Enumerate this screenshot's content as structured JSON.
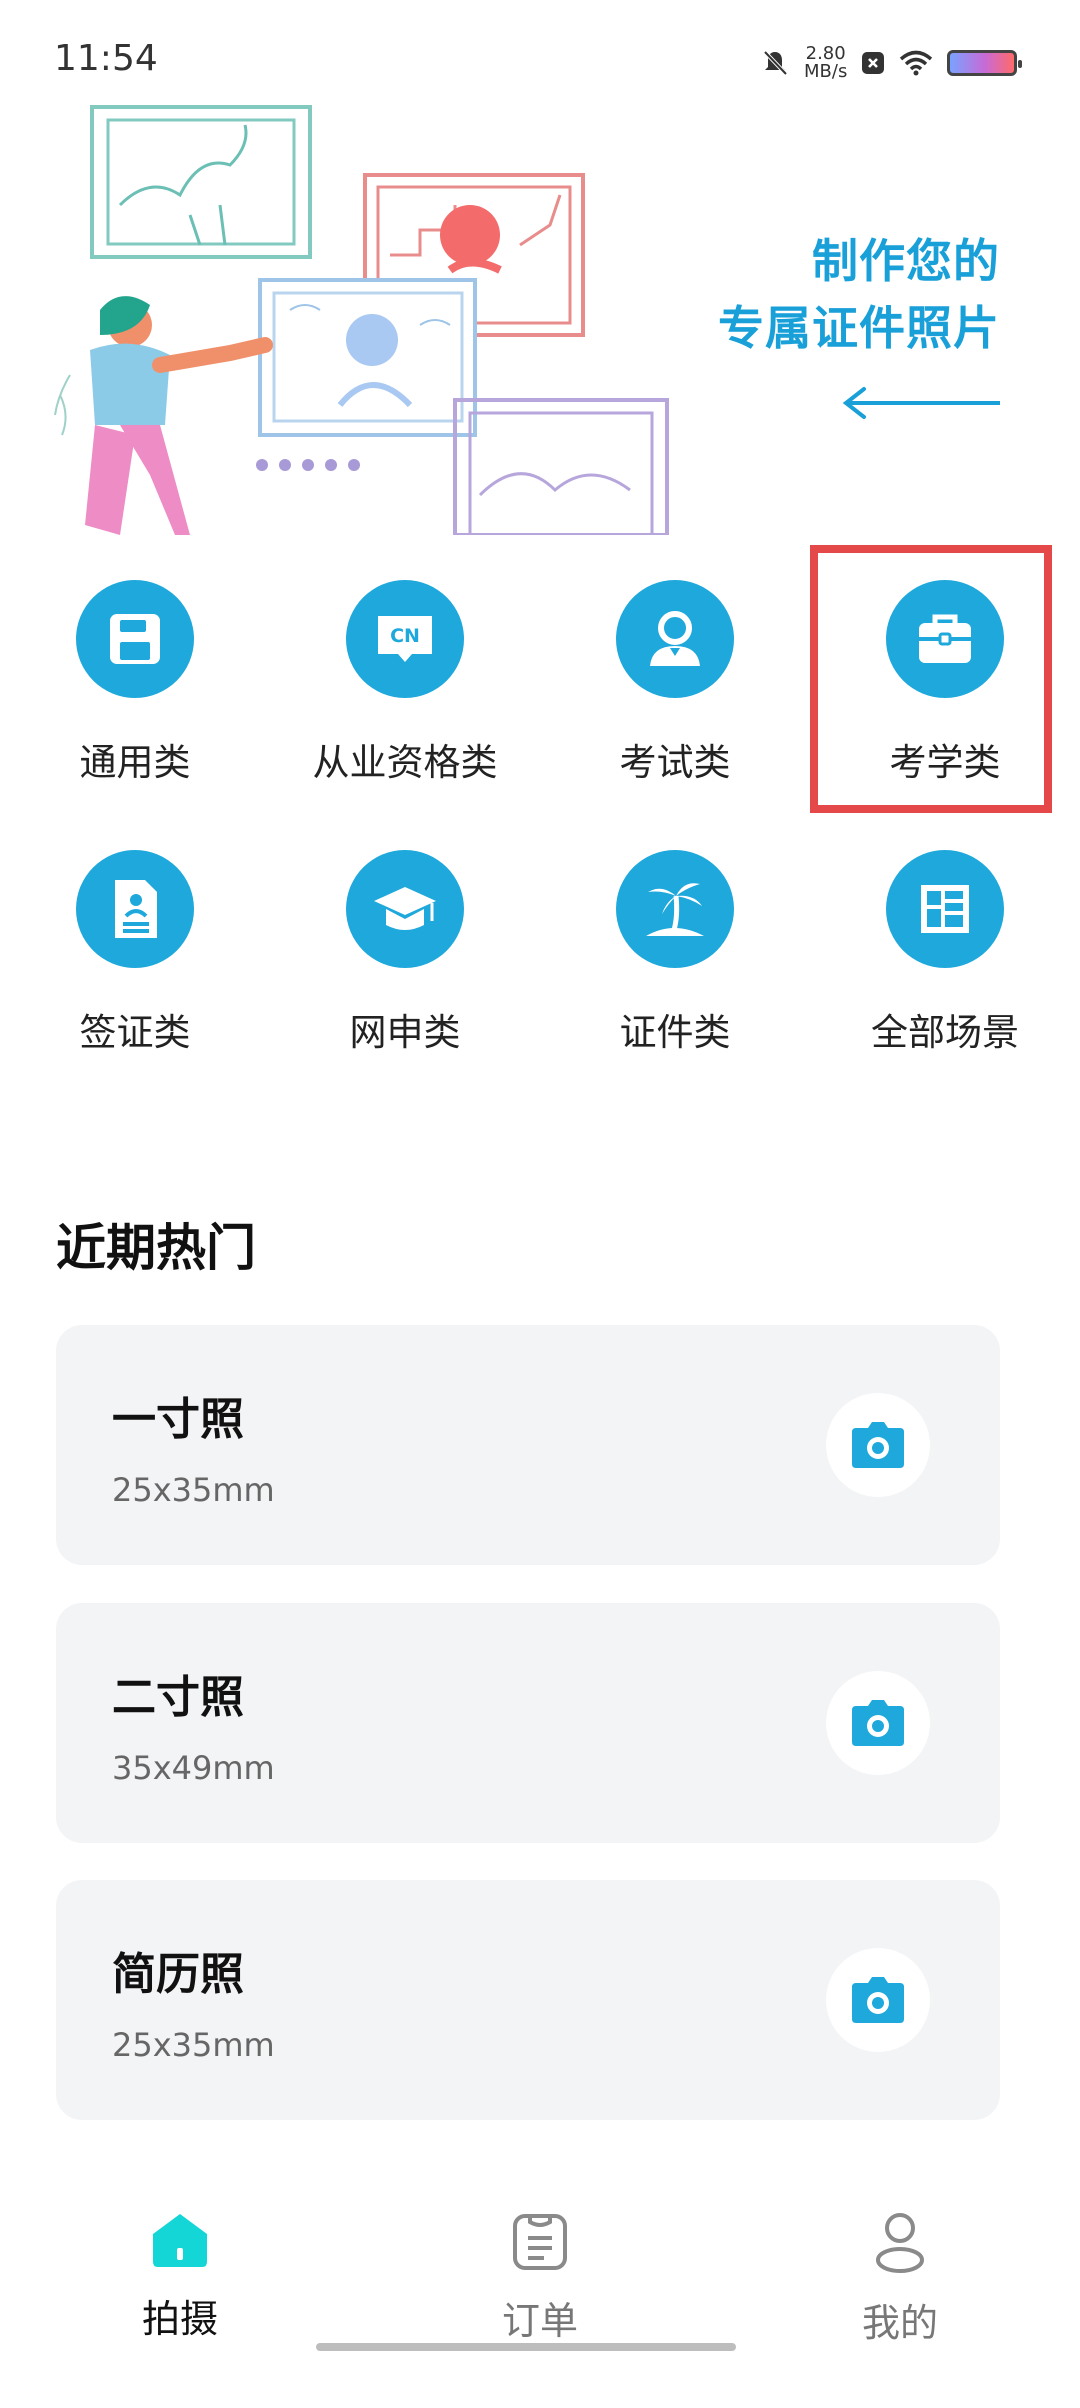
{
  "status_bar": {
    "time": "11:54",
    "speed_value": "2.80",
    "speed_unit": "MB/s"
  },
  "hero": {
    "line1": "制作您的",
    "line2": "专属证件照片"
  },
  "categories": [
    {
      "label": "通用类",
      "icon": "floppy-disk-icon"
    },
    {
      "label": "从业资格类",
      "icon": "cn-badge-icon",
      "badge": "CN"
    },
    {
      "label": "考试类",
      "icon": "person-icon"
    },
    {
      "label": "考学类",
      "icon": "briefcase-icon"
    },
    {
      "label": "签证类",
      "icon": "document-icon"
    },
    {
      "label": "网申类",
      "icon": "graduation-cap-icon"
    },
    {
      "label": "证件类",
      "icon": "palm-tree-icon"
    },
    {
      "label": "全部场景",
      "icon": "grid-layout-icon"
    }
  ],
  "recent": {
    "title": "近期热门",
    "items": [
      {
        "title": "一寸照",
        "size": "25x35mm"
      },
      {
        "title": "二寸照",
        "size": "35x49mm"
      },
      {
        "title": "简历照",
        "size": "25x35mm"
      }
    ]
  },
  "nav": {
    "items": [
      {
        "label": "拍摄",
        "active": true
      },
      {
        "label": "订单",
        "active": false
      },
      {
        "label": "我的",
        "active": false
      }
    ]
  },
  "colors": {
    "accent": "#1ea8dc",
    "active_nav": "#14d6d6",
    "highlight": "#e54848"
  }
}
